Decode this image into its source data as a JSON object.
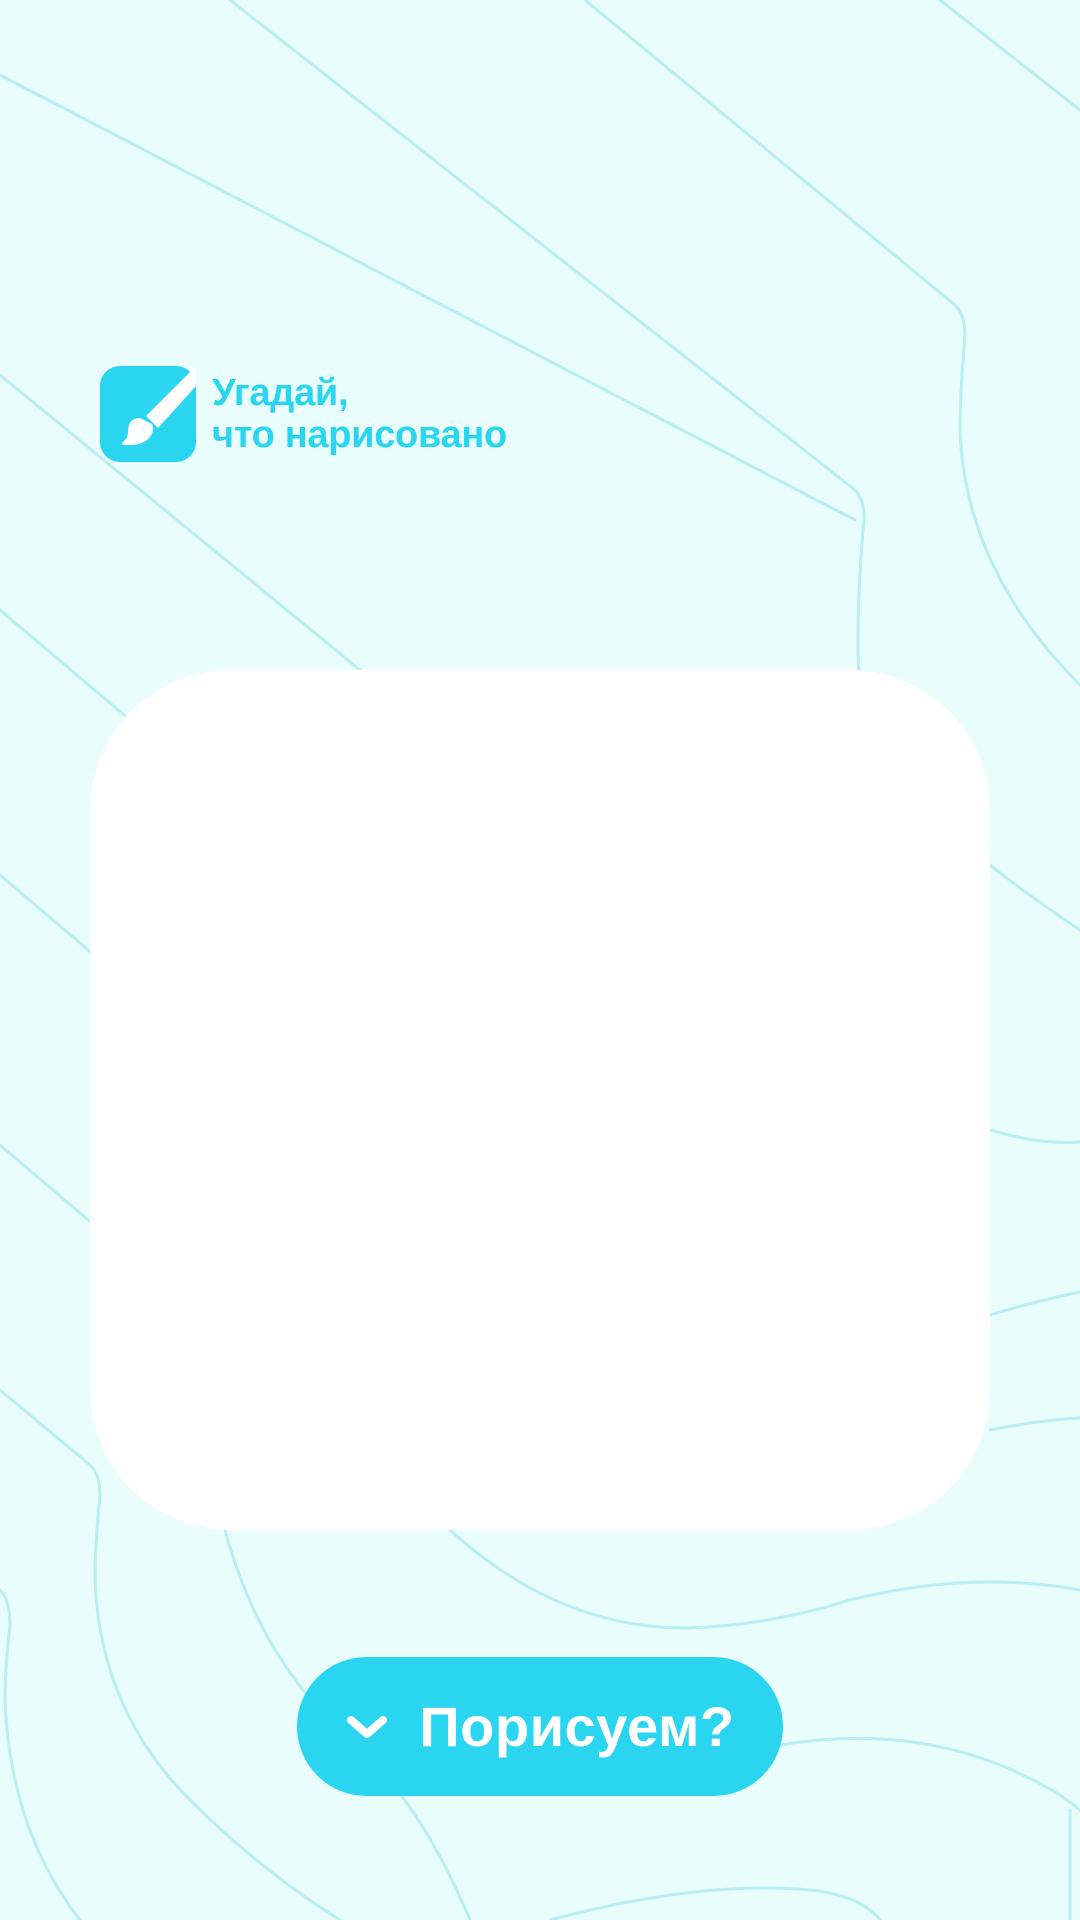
{
  "app": {
    "title_line1": "Угадай,",
    "title_line2": "что нарисовано",
    "logo_icon": "paintbrush-icon"
  },
  "actions": {
    "start_label": "Порисуем?",
    "start_icon": "chevron-down-icon"
  },
  "colors": {
    "accent": "#2ad5f0",
    "background": "#e8fdfc",
    "background_lines": "#b9eef3",
    "canvas": "#ffffff",
    "button_text": "#ffffff"
  }
}
